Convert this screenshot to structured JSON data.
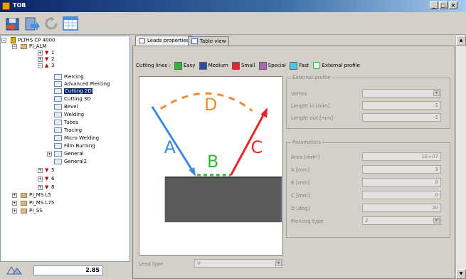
{
  "window": {
    "title": "TOB",
    "min": "_",
    "max": "□",
    "close": "×"
  },
  "toolbar": {
    "buttons": [
      "save-icon",
      "export-icon",
      "refresh-icon",
      "calendar-icon"
    ]
  },
  "tree": {
    "root": "PLTHS CP 4000",
    "alm": "PI_ALM",
    "n1": "1",
    "n2": "2",
    "n3": "3",
    "children3": [
      "Piercing",
      "Advanced Piercing",
      "Cutting 2D",
      "Cutting 3D",
      "Bevel",
      "Welding",
      "Tubes",
      "Tracing",
      "Micro Welding",
      "Film Burning",
      "General",
      "General2"
    ],
    "n5": "5",
    "n6": "6",
    "n8": "8",
    "ms_l5": "PI_MS L5",
    "ms_l75": "PI_MS L75",
    "ss": "PI_SS",
    "selected": "Cutting 2D"
  },
  "zoom": {
    "value": "2.85"
  },
  "tabs": {
    "leads": "Leads properties",
    "table": "Table view"
  },
  "legend": {
    "label": "Cutting lines :",
    "items": [
      {
        "name": "Easy",
        "color": "#2db83a"
      },
      {
        "name": "Medium",
        "color": "#2a4ea8"
      },
      {
        "name": "Small",
        "color": "#e52626"
      },
      {
        "name": "Special",
        "color": "#a868b8"
      },
      {
        "name": "Fast",
        "color": "#4fc8e8"
      }
    ],
    "external": "External profile"
  },
  "diagram": {
    "a": "A",
    "b": "B",
    "c": "C",
    "d": "D"
  },
  "external_profile": {
    "title": "External profile",
    "vertex_label": "Vertex",
    "vertex_value": "",
    "lenght_in_label": "Lenght in [mm]",
    "lenght_in_value": "-1",
    "lenght_out_label": "Lenght out [mm]",
    "lenght_out_value": "-1"
  },
  "parameters": {
    "title": "Parameters",
    "area_label": "Area [mm²]",
    "area_value": "1E+07",
    "a_label": "A [mm]",
    "a_value": "3",
    "b_label": "B [mm]",
    "b_value": "0",
    "c_label": "C [mm]",
    "c_value": "0",
    "d_label": "D [deg]",
    "d_value": "20",
    "piercing_label": "Piercing type",
    "piercing_value": "2"
  },
  "lead": {
    "label": "Lead type",
    "value": "V"
  }
}
